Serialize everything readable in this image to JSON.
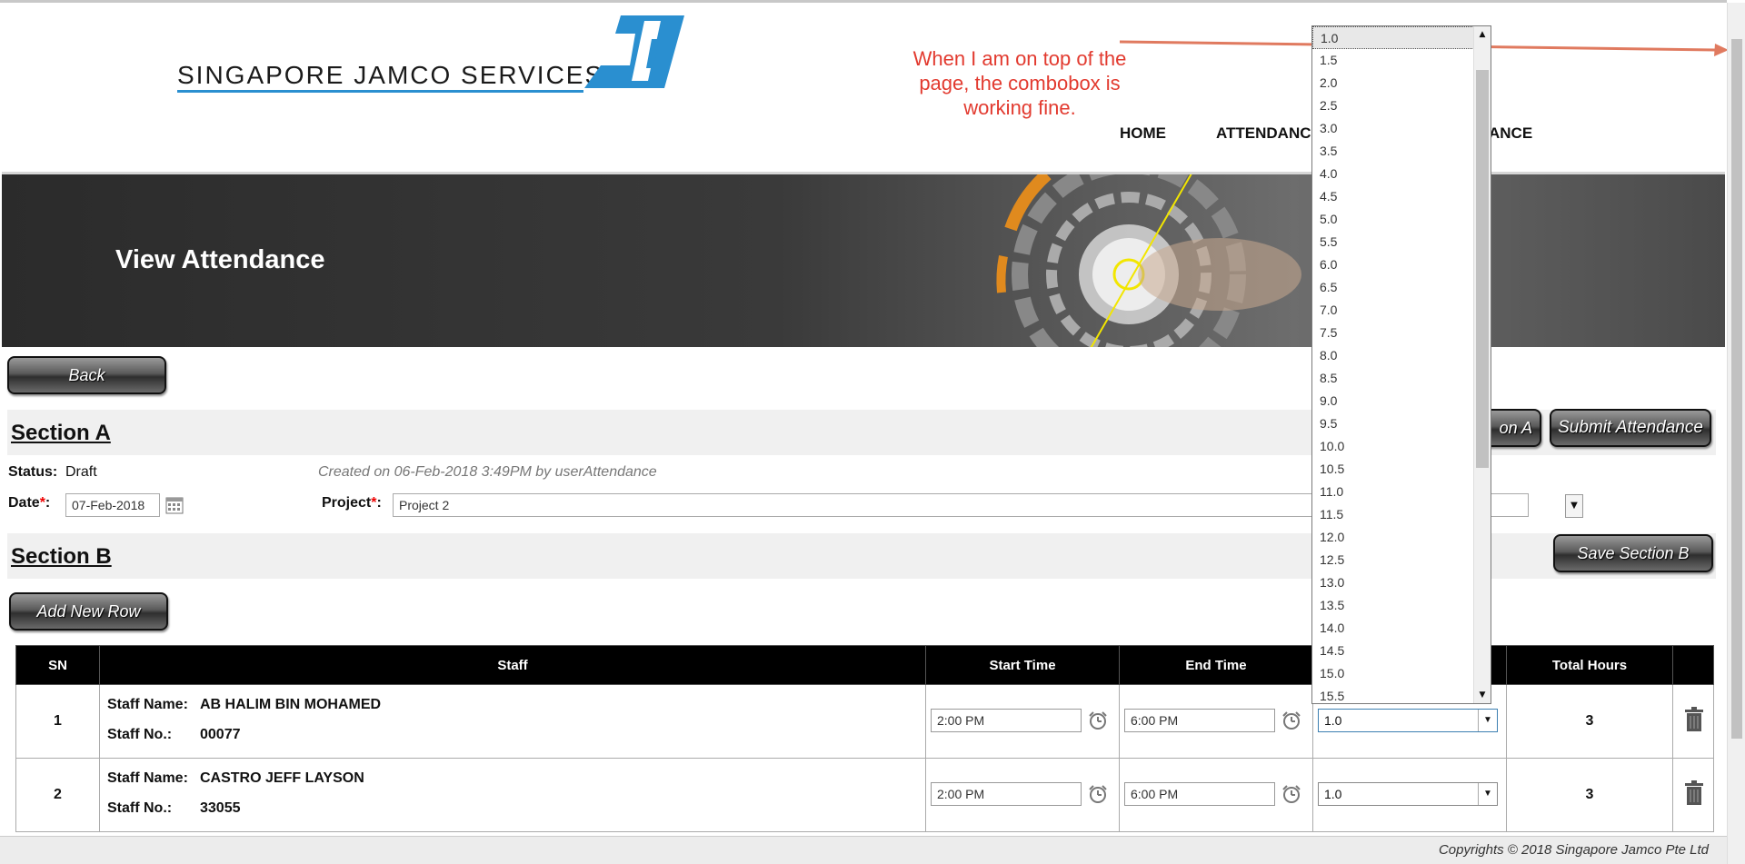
{
  "logo": {
    "text": "SINGAPORE JAMCO SERVICES"
  },
  "annotation": "When I am on top of the page, the combobox is working fine.",
  "nav": {
    "home": "HOME",
    "attendance": "ATTENDANCE",
    "attendance_tail": "ANCE"
  },
  "banner": {
    "title": "View Attendance"
  },
  "buttons": {
    "back": "Back",
    "section_a_partial": "on A",
    "submit": "Submit Attendance",
    "save_b": "Save Section B",
    "add_row": "Add New Row"
  },
  "section_a": {
    "title": "Section A",
    "status_label": "Status:",
    "status_value": "Draft",
    "created": "Created on 06-Feb-2018 3:49PM by userAttendance",
    "date_label": "Date",
    "date_value": "07-Feb-2018",
    "project_label": "Project",
    "project_value": "Project 2",
    "required_mark": "*"
  },
  "section_b": {
    "title": "Section B"
  },
  "table": {
    "headers": {
      "sn": "SN",
      "staff": "Staff",
      "start": "Start Time",
      "end": "End Time",
      "total": "Total Hours"
    },
    "staff_name_label": "Staff Name:",
    "staff_no_label": "Staff No.:",
    "rows": [
      {
        "sn": "1",
        "name": "AB HALIM BIN MOHAMED",
        "no": "00077",
        "start": "2:00 PM",
        "end": "6:00 PM",
        "hours": "1.0",
        "total": "3"
      },
      {
        "sn": "2",
        "name": "CASTRO JEFF LAYSON",
        "no": "33055",
        "start": "2:00 PM",
        "end": "6:00 PM",
        "hours": "1.0",
        "total": "3"
      }
    ]
  },
  "dropdown": {
    "selected": "1.0",
    "options": [
      "1.0",
      "1.5",
      "2.0",
      "2.5",
      "3.0",
      "3.5",
      "4.0",
      "4.5",
      "5.0",
      "5.5",
      "6.0",
      "6.5",
      "7.0",
      "7.5",
      "8.0",
      "8.5",
      "9.0",
      "9.5",
      "10.0",
      "10.5",
      "11.0",
      "11.5",
      "12.0",
      "12.5",
      "13.0",
      "13.5",
      "14.0",
      "14.5",
      "15.0",
      "15.5"
    ]
  },
  "footer": {
    "copyright": "Copyrights © 2018 Singapore Jamco Pte Ltd"
  },
  "colors": {
    "annotation": "#e23a2f",
    "logo_blue": "#2a8fd0",
    "required": "#ee0000"
  }
}
